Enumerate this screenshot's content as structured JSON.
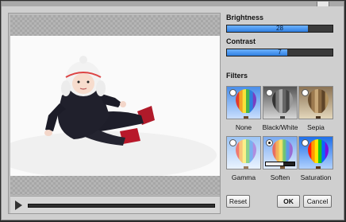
{
  "adjustments": {
    "brightness": {
      "label": "Brightness",
      "value": 28,
      "fill_percent": 77
    },
    "contrast": {
      "label": "Contrast",
      "value": 7,
      "fill_percent": 57
    }
  },
  "filters": {
    "label": "Filters",
    "selected": "Soften",
    "items": [
      {
        "label": "None",
        "style": "color"
      },
      {
        "label": "Black/White",
        "style": "grayscale"
      },
      {
        "label": "Sepia",
        "style": "sepia"
      },
      {
        "label": "Gamma",
        "style": "light"
      },
      {
        "label": "Soften",
        "style": "soft"
      },
      {
        "label": "Saturation",
        "style": "saturated"
      }
    ],
    "soften_level": 0.6
  },
  "player": {
    "progress": 0
  },
  "buttons": {
    "reset": "Reset",
    "ok": "OK",
    "cancel": "Cancel"
  },
  "icons": {
    "play": "play-icon"
  },
  "colors": {
    "slider_fill": "#2f7fe0",
    "panel_bg": "#cfcfcf"
  }
}
